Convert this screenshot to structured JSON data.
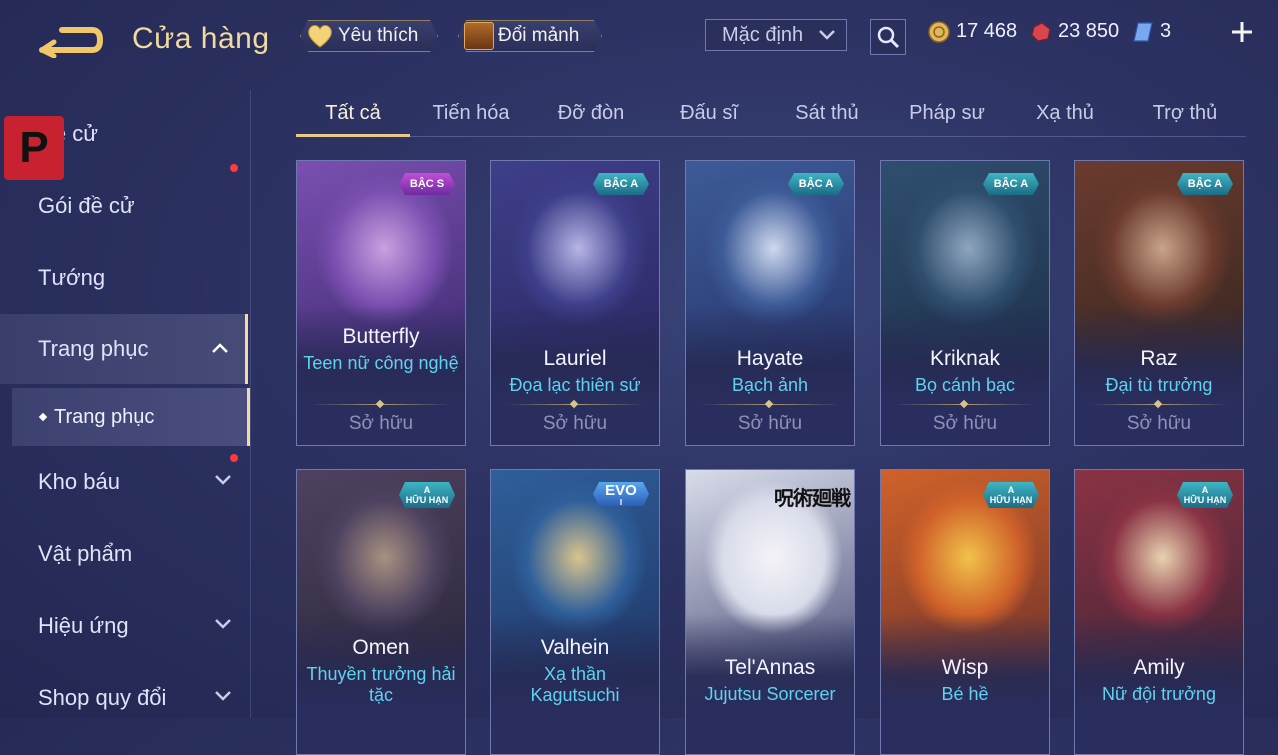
{
  "header": {
    "title": "Cửa hàng",
    "favorites_label": "Yêu thích",
    "exchange_label": "Đổi mảnh",
    "sort_value": "Mặc định",
    "currencies": [
      {
        "name": "gold",
        "amount": "17 468",
        "icon": "gold-coin-icon"
      },
      {
        "name": "gems",
        "amount": "23 850",
        "icon": "red-gem-icon"
      },
      {
        "name": "vouchers",
        "amount": "3",
        "icon": "voucher-icon"
      }
    ]
  },
  "sidebar": {
    "items": [
      {
        "label": "Đề cử",
        "has_dot": false,
        "chevron": "none"
      },
      {
        "label": "Gói đề cử",
        "has_dot": true,
        "chevron": "none"
      },
      {
        "label": "Tướng",
        "has_dot": false,
        "chevron": "none"
      },
      {
        "label": "Trang phục",
        "has_dot": false,
        "chevron": "up"
      },
      {
        "label": "Kho báu",
        "has_dot": true,
        "chevron": "down"
      },
      {
        "label": "Vật phẩm",
        "has_dot": false,
        "chevron": "none"
      },
      {
        "label": "Hiệu ứng",
        "has_dot": false,
        "chevron": "down"
      },
      {
        "label": "Shop quy đổi",
        "has_dot": false,
        "chevron": "down"
      }
    ],
    "subitem": "Trang phục",
    "logo_letter": "P"
  },
  "tabs": [
    "Tất cả",
    "Tiến hóa",
    "Đỡ đòn",
    "Đấu sĩ",
    "Sát thủ",
    "Pháp sư",
    "Xạ thủ",
    "Trợ thủ"
  ],
  "active_tab": 0,
  "cards": [
    {
      "hero": "Butterfly",
      "skin": "Teen nữ công nghệ",
      "status": "Sở hữu",
      "badge": "BẬC S",
      "badge_type": "s",
      "palette": [
        "#7a4fb0",
        "#c9a0e0",
        "#3b2a6e"
      ]
    },
    {
      "hero": "Lauriel",
      "skin": "Đọa lạc thiên sứ",
      "status": "Sở hữu",
      "badge": "BẬC A",
      "badge_type": "a",
      "palette": [
        "#3e3f8a",
        "#b7b4e6",
        "#2a2660"
      ]
    },
    {
      "hero": "Hayate",
      "skin": "Bạch ảnh",
      "status": "Sở hữu",
      "badge": "BẬC A",
      "badge_type": "a",
      "palette": [
        "#3d5b98",
        "#cfd9ee",
        "#26346a"
      ]
    },
    {
      "hero": "Kriknak",
      "skin": "Bọ cánh bạc",
      "status": "Sở hữu",
      "badge": "BẬC A",
      "badge_type": "a",
      "palette": [
        "#2f4e6e",
        "#8fa6bf",
        "#1d2f48"
      ]
    },
    {
      "hero": "Raz",
      "skin": "Đại tù trưởng",
      "status": "Sở hữu",
      "badge": "BẬC A",
      "badge_type": "a",
      "palette": [
        "#6b3b2e",
        "#c8a48a",
        "#34251f"
      ]
    },
    {
      "hero": "Omen",
      "skin": "Thuyền trưởng hải tặc",
      "status": "",
      "badge": "A",
      "badge_sub": "HỮU HẠN",
      "badge_type": "a lim",
      "palette": [
        "#4d4260",
        "#a89080",
        "#2b2538"
      ]
    },
    {
      "hero": "Valhein",
      "skin": "Xạ thần Kagutsuchi",
      "status": "",
      "badge": "EVO",
      "badge_sub": "I",
      "badge_type": "evo",
      "palette": [
        "#2f5f9a",
        "#d9c48c",
        "#1f3464"
      ]
    },
    {
      "hero": "Tel'Annas",
      "skin": "Jujutsu Sorcerer",
      "status": "",
      "badge": "呪術廻戦",
      "badge_type": "jjk",
      "palette": [
        "#d8dcea",
        "#f5f3f8",
        "#484a74"
      ]
    },
    {
      "hero": "Wisp",
      "skin": "Bé hề",
      "status": "",
      "badge": "A",
      "badge_sub": "HỮU HẠN",
      "badge_type": "a lim",
      "palette": [
        "#d0622a",
        "#f2c24a",
        "#6a2f2a"
      ]
    },
    {
      "hero": "Amily",
      "skin": "Nữ đội trưởng",
      "status": "",
      "badge": "A",
      "badge_sub": "HỮU HẠN",
      "badge_type": "a lim",
      "palette": [
        "#8a3344",
        "#e8d2b0",
        "#3e2436"
      ]
    }
  ],
  "colors": {
    "accent": "#f3d9a4",
    "skin_name": "#5fd2f0",
    "badge_a": "#2a8ea3",
    "badge_s": "#9b3bc0"
  }
}
